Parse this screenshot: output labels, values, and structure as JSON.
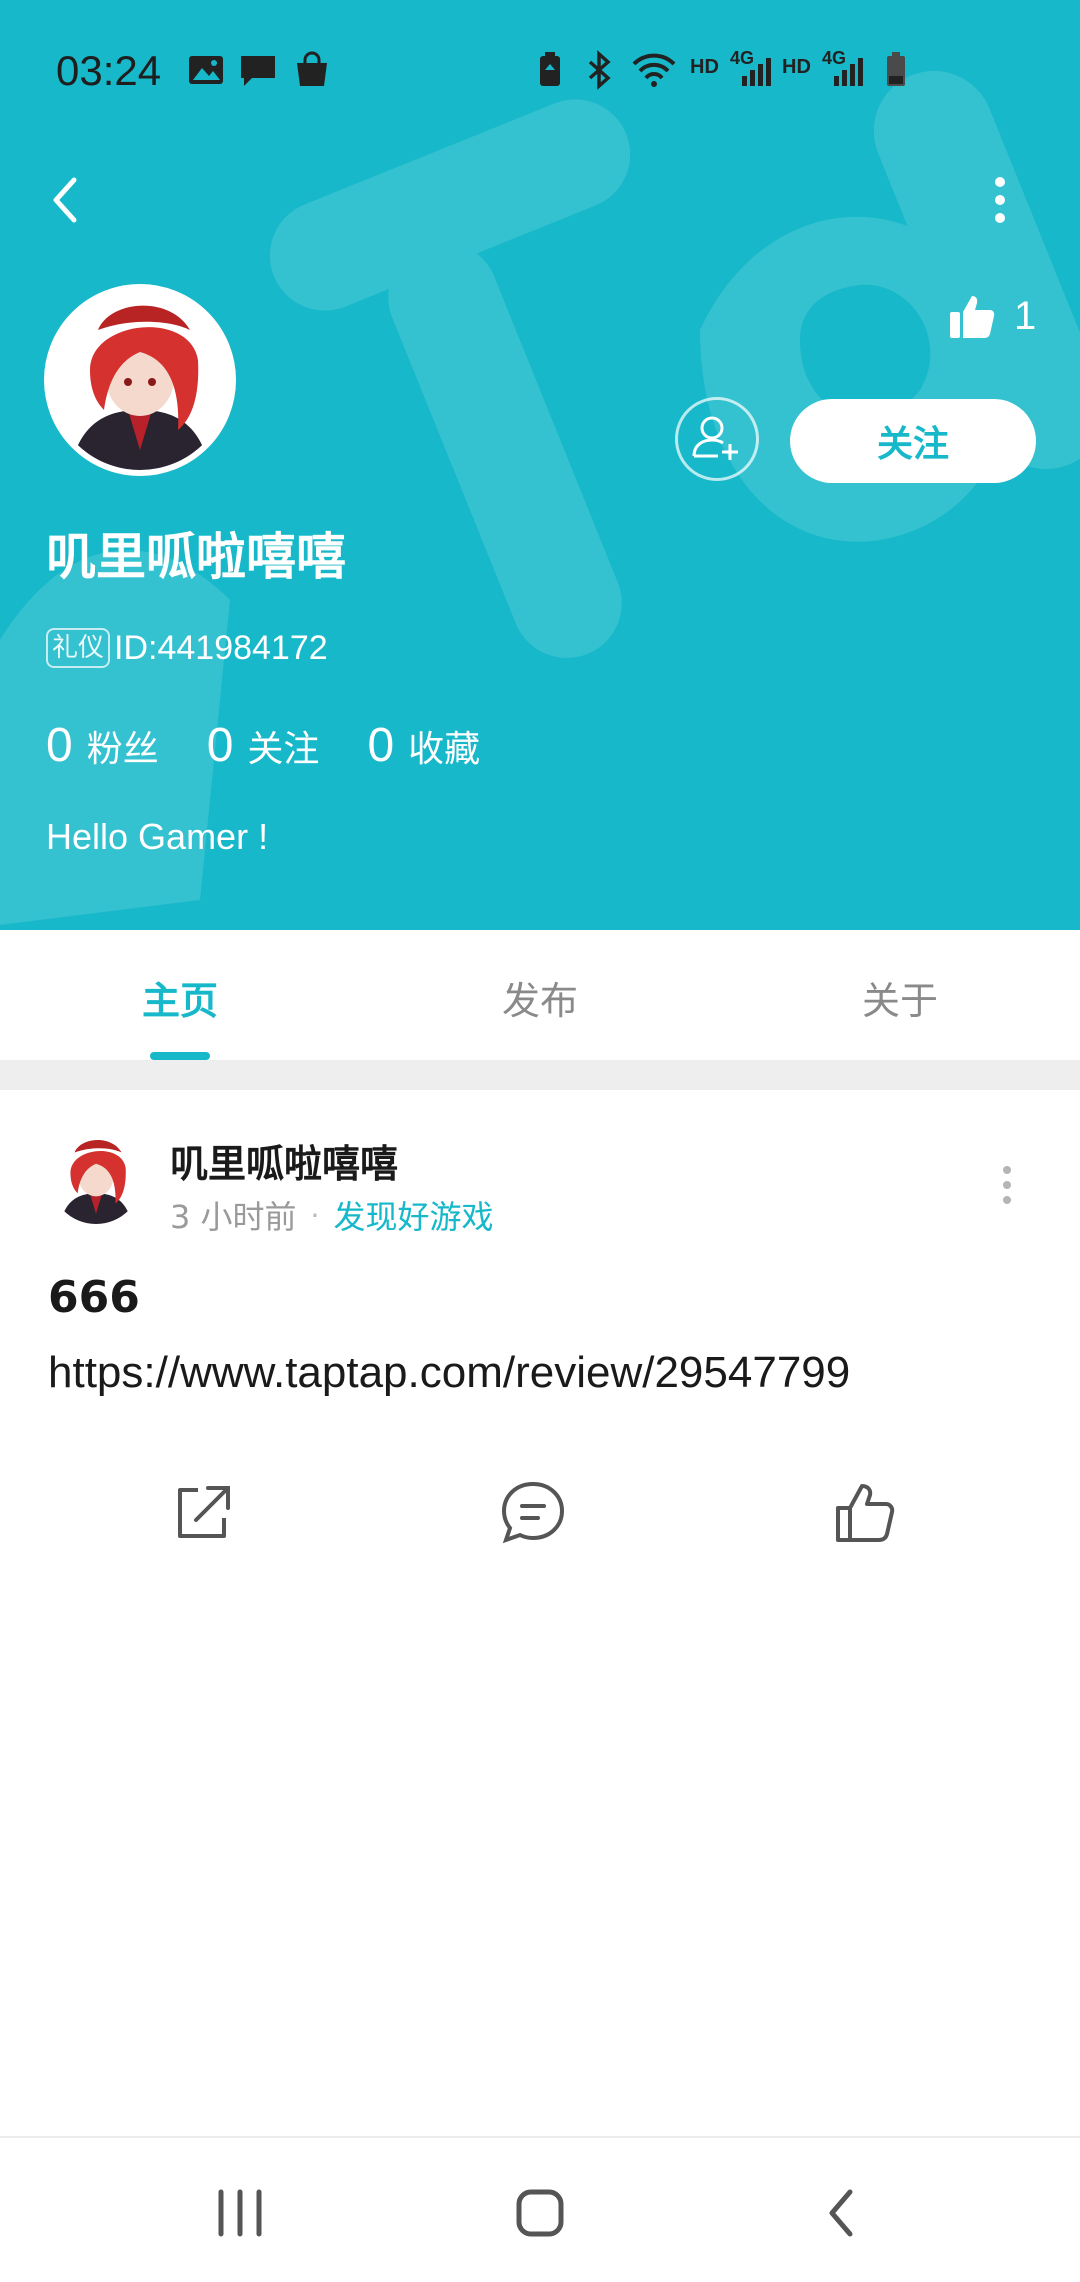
{
  "status_bar": {
    "time": "03:24",
    "indicators": [
      "image-icon",
      "message-icon",
      "shopping-bag-icon",
      "battery-saver-icon",
      "bluetooth-icon",
      "wifi-icon",
      "HD",
      "4G",
      "HD",
      "4G",
      "battery-icon"
    ],
    "hd1": "HD",
    "net1": "4G",
    "hd2": "HD",
    "net2": "4G"
  },
  "profile": {
    "likes_count": "1",
    "follow_label": "关注",
    "username": "叽里呱啦嘻嘻",
    "tag": "礼仪",
    "id_text": "ID:441984172",
    "stats": [
      {
        "value": "0",
        "label": "粉丝"
      },
      {
        "value": "0",
        "label": "关注"
      },
      {
        "value": "0",
        "label": "收藏"
      }
    ],
    "bio": "Hello Gamer !"
  },
  "tabs": [
    {
      "label": "主页",
      "active": true
    },
    {
      "label": "发布",
      "active": false
    },
    {
      "label": "关于",
      "active": false
    }
  ],
  "post": {
    "author": "叽里呱啦嘻嘻",
    "time": "3 小时前",
    "separator": "·",
    "topic": "发现好游戏",
    "title": "666",
    "body": "https://www.taptap.com/review/29547799",
    "actions": [
      "share-icon",
      "comment-icon",
      "like-icon"
    ]
  },
  "colors": {
    "accent": "#16b8c9",
    "header_bg": "#16b8c9",
    "secondary_text": "#9a9a9a"
  }
}
